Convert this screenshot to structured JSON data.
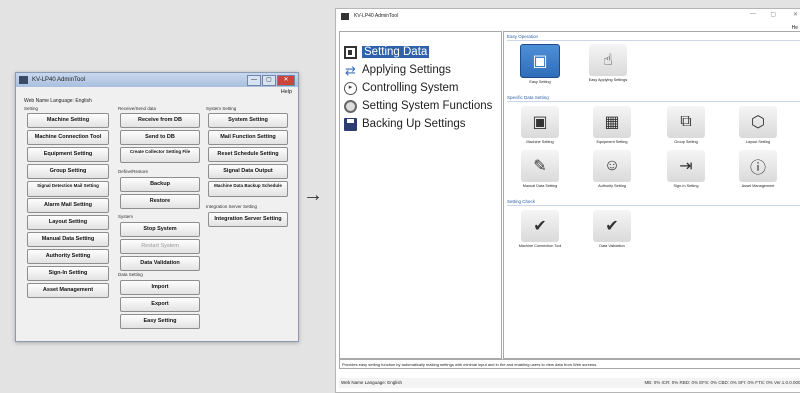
{
  "old_window": {
    "title": "KV-LP40 AdminTool",
    "controls": [
      "—",
      "▢",
      "✕"
    ],
    "menu_help": "Help",
    "language_label": "Web Name Language: English",
    "groups": {
      "setting": "Setting",
      "receive_send": "Receive/Send data",
      "system_setting": "System Setting",
      "define_restore": "Define/Restore",
      "system": "System",
      "data_setting": "Data Setting",
      "integration": "Integration Server Setting"
    },
    "col1": [
      "Machine Setting",
      "Machine Connection Tool",
      "Equipment Setting",
      "Group Setting",
      "Signal Detection Mail Setting",
      "Alarm Mail Setting",
      "Layout Setting",
      "Manual Data Setting",
      "Authority Setting",
      "Sign-In Setting",
      "Asset Management"
    ],
    "col2": [
      "Receive from DB",
      "Send to DB",
      "Create Collector Setting File",
      "Backup",
      "Restore",
      "Stop System",
      "Restart System",
      "Data Validation",
      "Import",
      "Export",
      "Easy Setting"
    ],
    "col3": [
      "System Setting",
      "Mail Function Setting",
      "Reset Schedule Setting",
      "Signal Data Output",
      "Machine Data Backup Schedule",
      "Integration Server Setting"
    ]
  },
  "arrow": "→",
  "new_window": {
    "title": "KV-LP40 AdminTool",
    "controls": [
      "—",
      "▢",
      "✕"
    ],
    "menu_help": "He",
    "nav": [
      "Setting Data",
      "Applying Settings",
      "Controlling System",
      "Setting System Functions",
      "Backing Up Settings"
    ],
    "sections": {
      "easy": "Easy Operation",
      "specific": "Specific Data Setting",
      "check": "Setting Check"
    },
    "easy_tiles": [
      "Easy Setting",
      "Easy Applying Settings"
    ],
    "specific_tiles": [
      "Machine Setting",
      "Equipment Setting",
      "Group Setting",
      "Layout Setting",
      "Manual Data Setting",
      "Authority Setting",
      "Sign-In Setting",
      "Asset Management"
    ],
    "check_tiles": [
      "Machine Connection Tool",
      "Data Validation"
    ],
    "description": "Provides easy setting function by automatically making settings with minimal input and in the and enabling users to view data from Web screens.",
    "status_left": "Web Name Language: English",
    "status_right": "MB: 0%   ICR: 0%   RBD: 0%   EFS: 0%   CBD: 0%   SFI: 0%   FTS: 0%   Ver.1.0.0.0000"
  }
}
